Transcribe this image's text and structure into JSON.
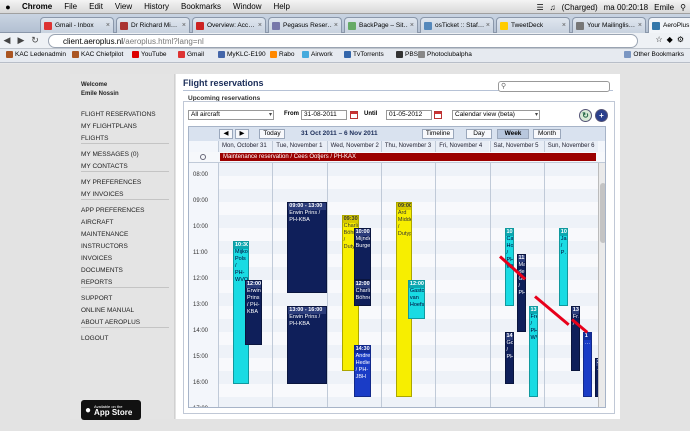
{
  "menubar": {
    "items": [
      "Chrome",
      "File",
      "Edit",
      "View",
      "History",
      "Bookmarks",
      "Window",
      "Help"
    ],
    "battery": "(Charged)",
    "clock": "ma 00:20:18",
    "user": "Emile"
  },
  "tabs": [
    {
      "label": "Gmail - Inbox",
      "color": "#d33"
    },
    {
      "label": "Dr Richard Mi…",
      "color": "#a33"
    },
    {
      "label": "Overview: Acc…",
      "color": "#c22"
    },
    {
      "label": "Pegasus Reser…",
      "color": "#77a"
    },
    {
      "label": "BackPage – Sit…",
      "color": "#6a6"
    },
    {
      "label": "osTicket :: Staf…",
      "color": "#58b"
    },
    {
      "label": "TweetDeck",
      "color": "#fc0"
    },
    {
      "label": "Your Mailinglis…",
      "color": "#777"
    },
    {
      "label": "AeroPlus - Bri…",
      "color": "#37a"
    }
  ],
  "toolbar": {
    "url_host": "client.aeroplus.nl",
    "url_path": "/aeroplus.html?lang=nl"
  },
  "bookmarks": [
    {
      "label": "KAC Ledenadmin",
      "color": "#a52"
    },
    {
      "label": "KAC Chiefpilot",
      "color": "#a52"
    },
    {
      "label": "YouTube",
      "color": "#d00"
    },
    {
      "label": "Gmail",
      "color": "#d33"
    },
    {
      "label": "MyKLC-E190",
      "color": "#46a"
    },
    {
      "label": "Rabo",
      "color": "#f80"
    },
    {
      "label": "Airwork",
      "color": "#4ad"
    },
    {
      "label": "TvTorrents",
      "color": "#36a"
    },
    {
      "label": "PBS",
      "color": "#333"
    },
    {
      "label": "Photoclubalpha",
      "color": "#888"
    }
  ],
  "other_bookmarks": "Other Bookmarks",
  "sidebar": {
    "welcome": "Welcome",
    "user": "Emile Nossin",
    "groups": [
      [
        "FLIGHT RESERVATIONS",
        "MY FLIGHTPLANS",
        "FLIGHTS"
      ],
      [
        "MY MESSAGES (0)",
        "MY CONTACTS"
      ],
      [
        "MY PREFERENCES",
        "MY INVOICES"
      ],
      [
        "APP PREFERENCES",
        "AIRCRAFT",
        "MAINTENANCE",
        "INSTRUCTORS",
        "INVOICES",
        "DOCUMENTS",
        "REPORTS"
      ],
      [
        "SUPPORT",
        "ONLINE MANUAL",
        "ABOUT AEROPLUS"
      ],
      [
        "LOGOUT"
      ]
    ],
    "appstore_line1": "Available on the",
    "appstore_line2": "App Store"
  },
  "main": {
    "title": "Flight reservations",
    "upcoming": "Upcoming reservations",
    "aircraft_select": "All aircraft",
    "from_label": "From",
    "from_value": "31-08-2011",
    "until_label": "Until",
    "until_value": "01-05-2012",
    "view_select": "Calendar view (beta)"
  },
  "calendar": {
    "today_label": "Today",
    "range": "31 Oct 2011 – 6 Nov 2011",
    "views": [
      "Timeline",
      "Day",
      "Week",
      "Month"
    ],
    "active_view": "Week",
    "days": [
      "Mon, October 31",
      "Tue, November 1",
      "Wed, November 2",
      "Thu, November 3",
      "Fri, November 4",
      "Sat, November 5",
      "Sun, November 6"
    ],
    "hours": [
      "08:00",
      "09:00",
      "10:00",
      "11:00",
      "12:00",
      "13:00",
      "14:00",
      "15:00",
      "16:00",
      "17:00",
      "18:00"
    ],
    "maintenance_label": "Maintenance reservation / Cees Ootjers / PH-KAX",
    "events": [
      {
        "day": 0,
        "col": 0,
        "start": 10.5,
        "end": 16.0,
        "time": "10:30",
        "text": "Mijko Pols / PH-WVO",
        "color": "cyan"
      },
      {
        "day": 0,
        "col": 1,
        "start": 12.0,
        "end": 14.5,
        "time": "12:00",
        "text": "Erwin Prins / PH-KBA",
        "color": "navy"
      },
      {
        "day": 1,
        "col": 0,
        "start": 9.0,
        "end": 12.5,
        "time": "09:00 - 13:00",
        "text": "Erwin Prins / PH-KBA",
        "color": "navy"
      },
      {
        "day": 1,
        "col": 0,
        "start": 13.0,
        "end": 16.0,
        "time": "13:00 - 16:00",
        "text": "Erwin Prins / PH-KBA",
        "color": "navy"
      },
      {
        "day": 2,
        "col": 0,
        "start": 9.5,
        "end": 15.5,
        "time": "09:30",
        "text": "Charlie Böhne / Dutyp…",
        "color": "yellow"
      },
      {
        "day": 2,
        "col": 1,
        "start": 10.0,
        "end": 12.0,
        "time": "10:00",
        "text": "Mijndert Burge…",
        "color": "navy"
      },
      {
        "day": 2,
        "col": 1,
        "start": 12.0,
        "end": 13.0,
        "time": "12:00",
        "text": "Charlie Böhne",
        "color": "navy"
      },
      {
        "day": 2,
        "col": 1,
        "start": 14.5,
        "end": 16.5,
        "time": "14:30",
        "text": "Andre Hedie / PH-JBH",
        "color": "blue"
      },
      {
        "day": 3,
        "col": 0,
        "start": 9.0,
        "end": 16.5,
        "time": "09:00",
        "text": "Ard Midde… / Dutyp…",
        "color": "yellow"
      },
      {
        "day": 3,
        "col": 1,
        "start": 12.0,
        "end": 13.5,
        "time": "12:00",
        "text": "Gaston van Hoefs…",
        "color": "cyan"
      },
      {
        "day": 5,
        "col": 0,
        "start": 10.0,
        "end": 13.0,
        "time": "10:0",
        "text": "Ca… Ho… / PH-WV…",
        "color": "cyan"
      },
      {
        "day": 5,
        "col": 1,
        "start": 11.0,
        "end": 14.0,
        "time": "11:0",
        "text": "Mar… de Gro… / PH…",
        "color": "navy"
      },
      {
        "day": 5,
        "col": 0,
        "start": 14.0,
        "end": 16.0,
        "time": "14:0",
        "text": "Gou… / PH…",
        "color": "navy"
      },
      {
        "day": 5,
        "col": 2,
        "start": 13.0,
        "end": 16.5,
        "time": "13:0",
        "text": "Fre… / PH-WV",
        "color": "cyan"
      },
      {
        "day": 6,
        "col": 0,
        "start": 10.0,
        "end": 13.0,
        "time": "10",
        "text": "Ja… / P…",
        "color": "cyan"
      },
      {
        "day": 6,
        "col": 1,
        "start": 13.0,
        "end": 15.5,
        "time": "13",
        "text": "Fr… /",
        "color": "navy"
      },
      {
        "day": 6,
        "col": 2,
        "start": 14.0,
        "end": 16.5,
        "time": "1",
        "text": "…",
        "color": "blue"
      },
      {
        "day": 6,
        "col": 3,
        "start": 15.0,
        "end": 16.5,
        "time": "14",
        "text": "…",
        "color": "navy"
      }
    ]
  }
}
